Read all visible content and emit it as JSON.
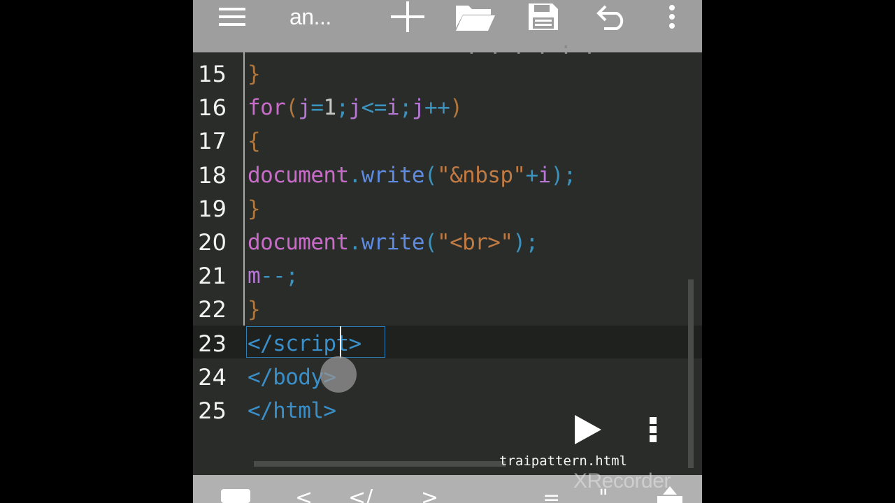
{
  "toolbar": {
    "title": "an...",
    "icons": [
      "menu-icon",
      "plus-icon",
      "folder-open-icon",
      "save-icon",
      "undo-icon",
      "more-vertical-icon"
    ]
  },
  "editor": {
    "partial_top_text": ". . . . ; .",
    "lines": [
      {
        "num": "15",
        "tokens": [
          {
            "t": "}",
            "c": "pn"
          }
        ]
      },
      {
        "num": "16",
        "tokens": [
          {
            "t": "for",
            "c": "kw"
          },
          {
            "t": "(",
            "c": "pn"
          },
          {
            "t": "j",
            "c": "vr"
          },
          {
            "t": "=",
            "c": "op"
          },
          {
            "t": "1",
            "c": "nm"
          },
          {
            "t": ";",
            "c": "op"
          },
          {
            "t": "j",
            "c": "vr"
          },
          {
            "t": "<=",
            "c": "op"
          },
          {
            "t": "i",
            "c": "vr"
          },
          {
            "t": ";",
            "c": "op"
          },
          {
            "t": "j",
            "c": "vr"
          },
          {
            "t": "++",
            "c": "op"
          },
          {
            "t": ")",
            "c": "pn"
          }
        ]
      },
      {
        "num": "17",
        "tokens": [
          {
            "t": "{",
            "c": "pn"
          }
        ]
      },
      {
        "num": "18",
        "tokens": [
          {
            "t": "document",
            "c": "kw"
          },
          {
            "t": ".",
            "c": "op"
          },
          {
            "t": "write",
            "c": "mt"
          },
          {
            "t": "(",
            "c": "op"
          },
          {
            "t": "\"&nbsp\"",
            "c": "str"
          },
          {
            "t": "+",
            "c": "op"
          },
          {
            "t": "i",
            "c": "vr"
          },
          {
            "t": ");",
            "c": "op"
          }
        ]
      },
      {
        "num": "19",
        "tokens": [
          {
            "t": "}",
            "c": "pn"
          }
        ]
      },
      {
        "num": "20",
        "tokens": [
          {
            "t": "document",
            "c": "kw"
          },
          {
            "t": ".",
            "c": "op"
          },
          {
            "t": "write",
            "c": "mt"
          },
          {
            "t": "(",
            "c": "op"
          },
          {
            "t": "\"<br>\"",
            "c": "str"
          },
          {
            "t": ");",
            "c": "op"
          }
        ]
      },
      {
        "num": "21",
        "tokens": [
          {
            "t": "m",
            "c": "vr"
          },
          {
            "t": "--;",
            "c": "op"
          }
        ]
      },
      {
        "num": "22",
        "tokens": [
          {
            "t": "}",
            "c": "pn"
          }
        ]
      },
      {
        "num": "23",
        "tokens": [
          {
            "t": "</",
            "c": "tag"
          },
          {
            "t": "script",
            "c": "tag"
          },
          {
            "t": ">",
            "c": "tag"
          }
        ]
      },
      {
        "num": "24",
        "tokens": [
          {
            "t": "</",
            "c": "tag"
          },
          {
            "t": "body",
            "c": "tag"
          },
          {
            "t": ">",
            "c": "tag"
          }
        ]
      },
      {
        "num": "25",
        "tokens": [
          {
            "t": "</",
            "c": "tag"
          },
          {
            "t": "html",
            "c": "tag"
          },
          {
            "t": ">",
            "c": "tag"
          }
        ]
      }
    ]
  },
  "file": {
    "name": "traipattern.html",
    "run_icon": "play-icon",
    "more_icon": "more-vertical-icon"
  },
  "symbol_bar": {
    "keys": [
      "<",
      "</",
      ">",
      "=",
      "\""
    ]
  },
  "watermark": "XRecorder"
}
